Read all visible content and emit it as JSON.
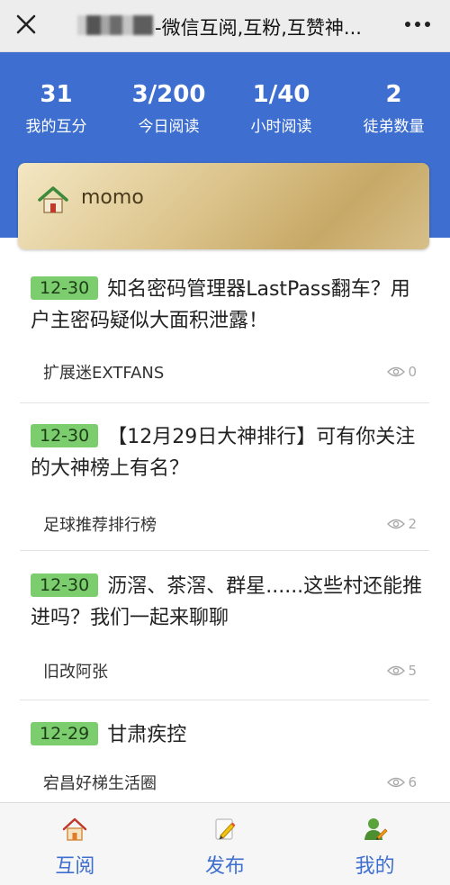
{
  "navbar": {
    "title": "-微信互阅,互粉,互赞神..."
  },
  "stats": [
    {
      "value": "31",
      "label": "我的互分"
    },
    {
      "value": "3/200",
      "label": "今日阅读"
    },
    {
      "value": "1/40",
      "label": "小时阅读"
    },
    {
      "value": "2",
      "label": "徒弟数量"
    }
  ],
  "user": {
    "name": "momo"
  },
  "articles": [
    {
      "date": "12-30",
      "title": "知名密码管理器LastPass翻车？用户主密码疑似大面积泄露！",
      "source": "扩展迷EXTFANS",
      "views": "0"
    },
    {
      "date": "12-30",
      "title": "【12月29日大神排行】可有你关注的大神榜上有名？",
      "source": "足球推荐排行榜",
      "views": "2"
    },
    {
      "date": "12-30",
      "title": "沥滘、茶滘、群星......这些村还能推进吗？我们一起来聊聊",
      "source": "旧改阿张",
      "views": "5"
    },
    {
      "date": "12-29",
      "title": "甘肃疾控",
      "source": "宕昌好梯生活圈",
      "views": "6"
    }
  ],
  "tabs": [
    {
      "label": "互阅",
      "icon": "home-icon"
    },
    {
      "label": "发布",
      "icon": "pencil-icon"
    },
    {
      "label": "我的",
      "icon": "user-icon"
    }
  ],
  "colors": {
    "header_blue": "#3e6fd0",
    "date_tag_green": "#7ccd6e"
  }
}
